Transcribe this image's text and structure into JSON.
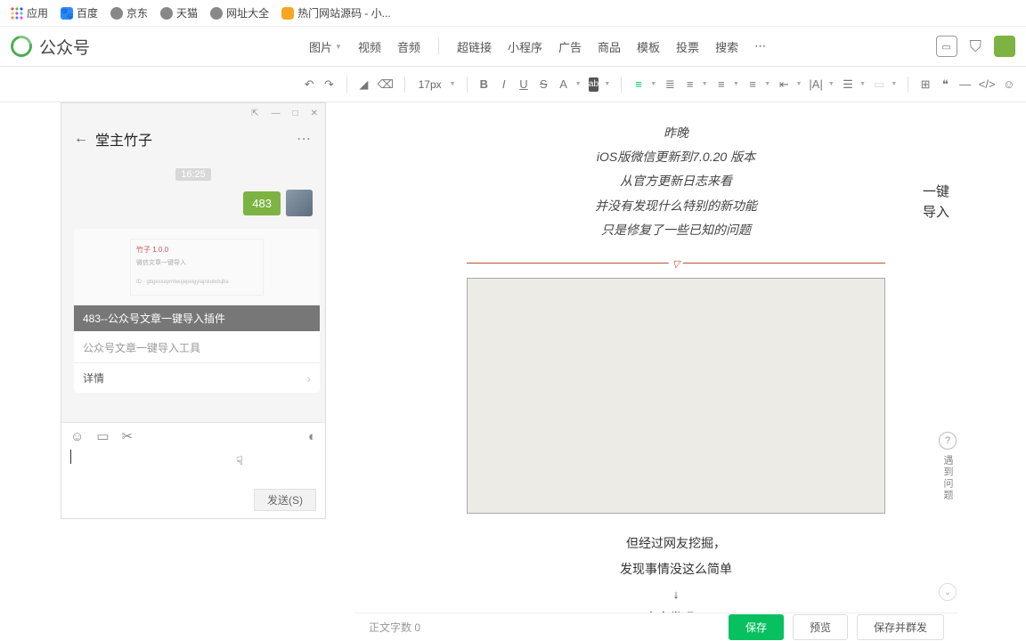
{
  "bookmarks": [
    {
      "label": "应用",
      "icon": "apps"
    },
    {
      "label": "百度",
      "icon": "baidu"
    },
    {
      "label": "京东",
      "icon": "globe"
    },
    {
      "label": "天猫",
      "icon": "globe"
    },
    {
      "label": "网址大全",
      "icon": "globe"
    },
    {
      "label": "热门网站源码 - 小...",
      "icon": "orange"
    }
  ],
  "app": {
    "title": "公众号"
  },
  "menu": {
    "items": [
      "图片",
      "视频",
      "音频",
      "超链接",
      "小程序",
      "广告",
      "商品",
      "模板",
      "投票",
      "搜索"
    ],
    "has_dropdown": [
      true,
      false,
      false,
      false,
      false,
      false,
      false,
      false,
      false,
      false
    ]
  },
  "toolbar": {
    "font_size": "17px"
  },
  "chat": {
    "title": "堂主竹子",
    "time": "16:25",
    "badge": "483",
    "card_title": "483--公众号文章一键导入插件",
    "card_sub": "公众号文章一键导入工具",
    "card_detail": "详情",
    "preview_line1": "竹子 1.0.0",
    "preview_line2": "微信文章一键导入",
    "preview_line3": "ID - gbgesxayrnlwujepeigyiajnkobdsjba",
    "send": "发送(S)"
  },
  "editor": {
    "lines": [
      "昨晚",
      "iOS版微信更新到7.0.20 版本",
      "从官方更新日志来看",
      "并没有发现什么特别的新功能",
      "只是修复了一些已知的问题"
    ],
    "lines2": [
      "但经过网友挖掘，",
      "发现事情没这么简单",
      "↓",
      "大家发现，"
    ]
  },
  "side": {
    "import": "一键\n导入",
    "help": "遇到问题"
  },
  "footer": {
    "word_count_label": "正文字数",
    "word_count": "0",
    "save": "保存",
    "preview": "预览",
    "save_publish": "保存并群发"
  }
}
